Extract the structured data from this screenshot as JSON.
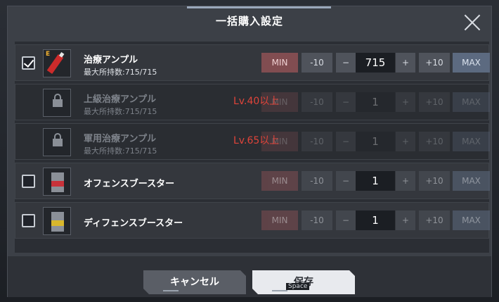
{
  "dialog": {
    "title": "一括購入設定",
    "cancel_label": "キャンセル",
    "save_label": "保存",
    "save_hint": "Space"
  },
  "controls": {
    "min": "MIN",
    "minus10": "-10",
    "minus": "−",
    "plus": "+",
    "plus10": "+10",
    "max": "MAX"
  },
  "items": [
    {
      "name": "治療アンプル",
      "max_own": "最大所持数:715/715",
      "quantity": "715",
      "checked": true,
      "locked": false,
      "icon": "healing-ampoule-icon"
    },
    {
      "name": "上級治療アンプル",
      "max_own": "最大所持数:715/715",
      "quantity": "1",
      "locked": true,
      "lock_text": "Lv.40以上",
      "icon": "lock-icon"
    },
    {
      "name": "軍用治療アンプル",
      "max_own": "最大所持数:715/715",
      "quantity": "1",
      "locked": true,
      "lock_text": "Lv.65以上",
      "icon": "lock-icon"
    },
    {
      "name": "オフェンスブースター",
      "quantity": "1",
      "checked": false,
      "locked": false,
      "icon": "offense-booster-icon",
      "band_color": "#c8323a"
    },
    {
      "name": "ディフェンスブースター",
      "quantity": "1",
      "checked": false,
      "locked": false,
      "icon": "defense-booster-icon",
      "band_color": "#d8b72c"
    }
  ],
  "colors": {
    "min_button": "#814d51",
    "max_button": "#5c6a80",
    "lock_text": "#e0443a"
  }
}
